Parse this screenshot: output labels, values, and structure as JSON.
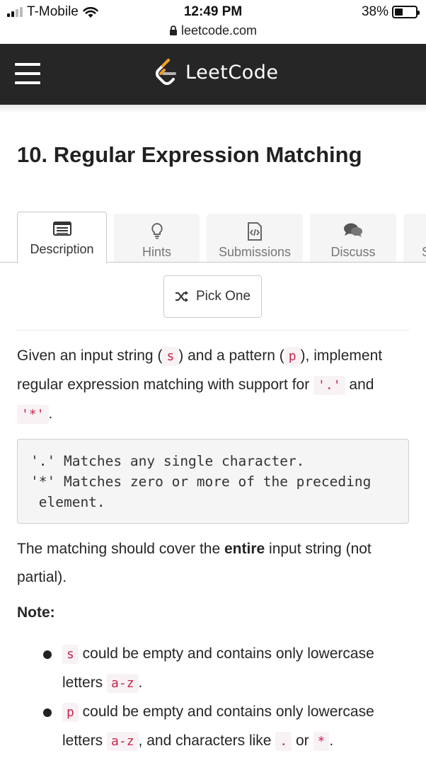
{
  "status_bar": {
    "carrier": "T-Mobile",
    "time": "12:49 PM",
    "url": "leetcode.com",
    "battery": "38%",
    "battery_level": 0.38
  },
  "navbar": {
    "brand": "LeetCode",
    "icons": [
      "menu-icon",
      "leetcode-logo-icon"
    ]
  },
  "problem": {
    "title": "10. Regular Expression Matching"
  },
  "tabs": [
    {
      "label": "Description",
      "icon": "description-icon",
      "active": true
    },
    {
      "label": "Hints",
      "icon": "lightbulb-icon",
      "active": false
    },
    {
      "label": "Submissions",
      "icon": "code-file-icon",
      "active": false
    },
    {
      "label": "Discuss",
      "icon": "chat-icon",
      "active": false
    },
    {
      "label": "S",
      "icon": "",
      "active": false
    }
  ],
  "pick_one": {
    "label": "Pick One",
    "icon": "shuffle-icon"
  },
  "description": {
    "p1_a": "Given an input string (",
    "p1_s": "s",
    "p1_b": ") and a pattern (",
    "p1_p": "p",
    "p1_c": "), implement regular expression matching with support for ",
    "p1_dot": "'.'",
    "p1_d": " and ",
    "p1_star": "'*'",
    "p1_e": ".",
    "pre": "'.' Matches any single character.\n'*' Matches zero or more of the preceding\n element.",
    "p2_a": "The matching should cover the ",
    "p2_bold": "entire",
    "p2_b": " input string (not partial).",
    "note": "Note:",
    "b1_code": "s",
    "b1_a": " could be empty and contains only lowercase letters ",
    "b1_code2": "a-z",
    "b1_b": ".",
    "b2_code": "p",
    "b2_a": " could be empty and contains only lowercase letters ",
    "b2_code2": "a-z",
    "b2_b": ", and characters like ",
    "b2_code3": ".",
    "b2_c": " or ",
    "b2_code4": "*",
    "b2_d": "."
  }
}
